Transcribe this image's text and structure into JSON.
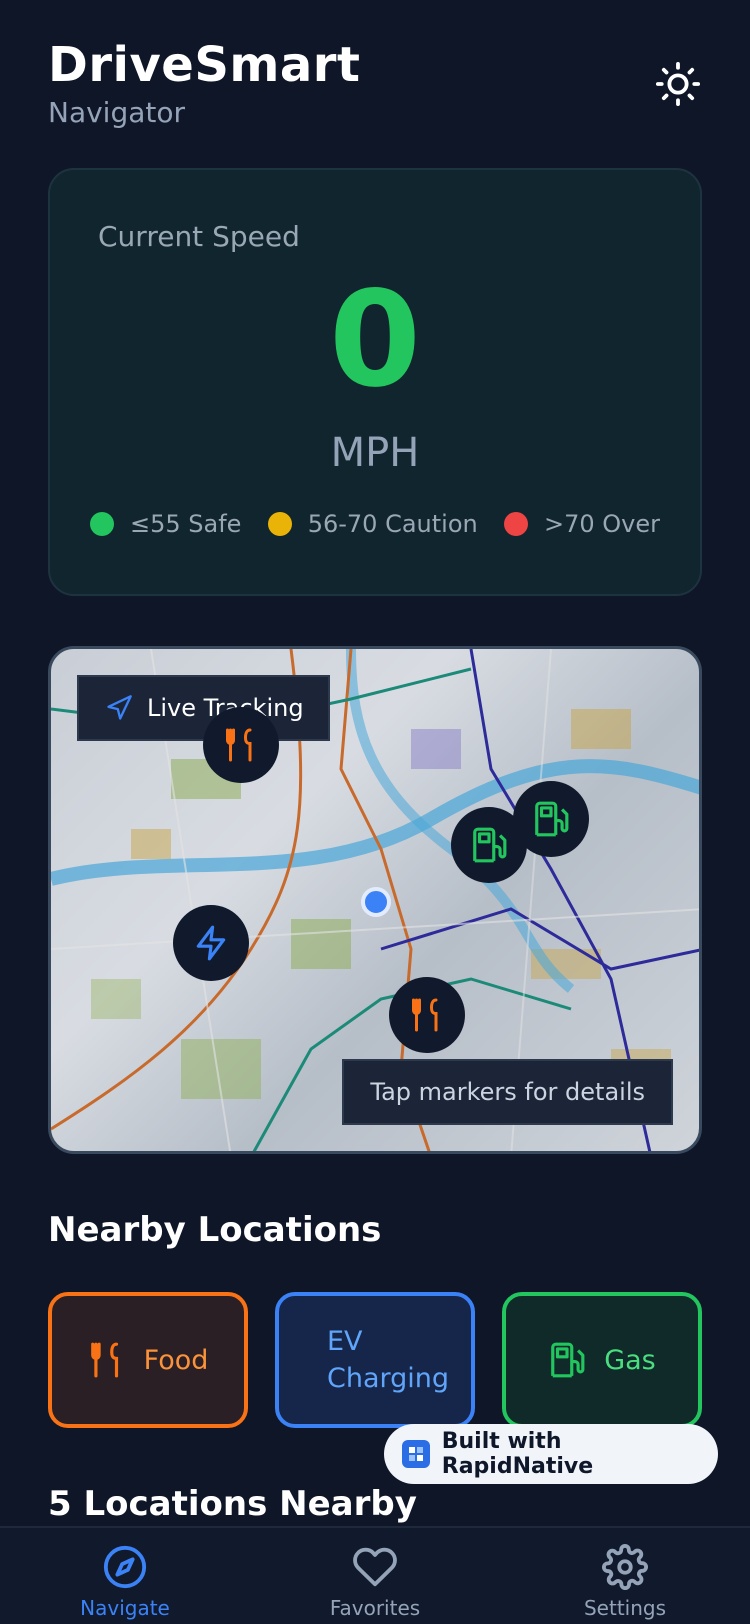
{
  "header": {
    "title": "DriveSmart",
    "subtitle": "Navigator"
  },
  "speed": {
    "label": "Current Speed",
    "value": "0",
    "unit": "MPH",
    "legend": [
      {
        "label": "≤55 Safe",
        "color": "#22c55e"
      },
      {
        "label": "56-70 Caution",
        "color": "#eab308"
      },
      {
        "label": ">70 Over",
        "color": "#ef4444"
      }
    ]
  },
  "map": {
    "live_label": "Live Tracking",
    "hint": "Tap markers for details",
    "markers": [
      {
        "type": "food",
        "icon": "utensils-icon"
      },
      {
        "type": "gas",
        "icon": "fuel-pump-icon"
      },
      {
        "type": "gas",
        "icon": "fuel-pump-icon"
      },
      {
        "type": "ev",
        "icon": "lightning-icon"
      },
      {
        "type": "food",
        "icon": "utensils-icon"
      }
    ]
  },
  "nearby": {
    "title": "Nearby Locations",
    "categories": [
      {
        "label": "Food",
        "color": "#f97316"
      },
      {
        "label_line1": "EV",
        "label_line2": "Charging",
        "color": "#3b82f6"
      },
      {
        "label": "Gas",
        "color": "#22c55e"
      }
    ]
  },
  "results_title": "5 Locations Nearby",
  "badge": {
    "label": "Built with RapidNative"
  },
  "tabs": [
    {
      "label": "Navigate",
      "icon": "compass-icon",
      "active": true
    },
    {
      "label": "Favorites",
      "icon": "heart-icon",
      "active": false
    },
    {
      "label": "Settings",
      "icon": "gear-icon",
      "active": false
    }
  ],
  "colors": {
    "background": "#0e1628",
    "accent": "#3b82f6",
    "speed": "#22c55e"
  }
}
